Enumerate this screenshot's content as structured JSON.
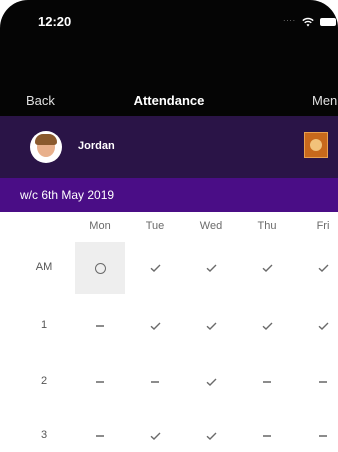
{
  "status_bar": {
    "time": "12:20",
    "signal_dots": "....",
    "wifi_icon": "wifi-icon",
    "battery_icon": "battery-icon"
  },
  "nav": {
    "back_label": "Back",
    "title": "Attendance",
    "menu_label": "Menu"
  },
  "profile": {
    "name": "Jordan",
    "avatar_icon": "child-avatar",
    "logo_icon": "school-logo-icon"
  },
  "week": {
    "label": "w/c 6th May 2019"
  },
  "attendance": {
    "days": [
      "Mon",
      "Tue",
      "Wed",
      "Thu",
      "Fri"
    ],
    "sessions": [
      {
        "label": "AM",
        "marks": [
          "circle",
          "tick",
          "tick",
          "tick",
          "tick"
        ]
      },
      {
        "label": "1",
        "marks": [
          "dash",
          "tick",
          "tick",
          "tick",
          "tick"
        ]
      },
      {
        "label": "2",
        "marks": [
          "dash",
          "dash",
          "tick",
          "dash",
          "dash"
        ]
      },
      {
        "label": "3",
        "marks": [
          "dash",
          "tick",
          "tick",
          "dash",
          "dash"
        ]
      }
    ],
    "selected": {
      "session": 0,
      "day": 0
    }
  },
  "colors": {
    "header_bg": "#050505",
    "profile_bg": "#2a1447",
    "week_bar_bg": "#4a0d86"
  }
}
